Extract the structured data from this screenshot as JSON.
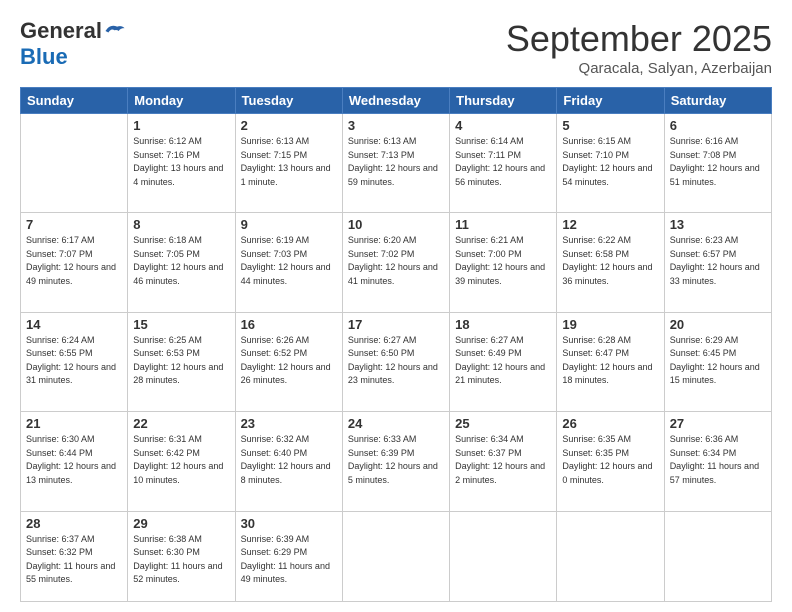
{
  "logo": {
    "general": "General",
    "blue": "Blue"
  },
  "header": {
    "month": "September 2025",
    "location": "Qaracala, Salyan, Azerbaijan"
  },
  "days": [
    "Sunday",
    "Monday",
    "Tuesday",
    "Wednesday",
    "Thursday",
    "Friday",
    "Saturday"
  ],
  "weeks": [
    [
      {
        "day": "",
        "sunrise": "",
        "sunset": "",
        "daylight": ""
      },
      {
        "day": "1",
        "sunrise": "6:12 AM",
        "sunset": "7:16 PM",
        "daylight": "13 hours and 4 minutes."
      },
      {
        "day": "2",
        "sunrise": "6:13 AM",
        "sunset": "7:15 PM",
        "daylight": "13 hours and 1 minute."
      },
      {
        "day": "3",
        "sunrise": "6:13 AM",
        "sunset": "7:13 PM",
        "daylight": "12 hours and 59 minutes."
      },
      {
        "day": "4",
        "sunrise": "6:14 AM",
        "sunset": "7:11 PM",
        "daylight": "12 hours and 56 minutes."
      },
      {
        "day": "5",
        "sunrise": "6:15 AM",
        "sunset": "7:10 PM",
        "daylight": "12 hours and 54 minutes."
      },
      {
        "day": "6",
        "sunrise": "6:16 AM",
        "sunset": "7:08 PM",
        "daylight": "12 hours and 51 minutes."
      }
    ],
    [
      {
        "day": "7",
        "sunrise": "6:17 AM",
        "sunset": "7:07 PM",
        "daylight": "12 hours and 49 minutes."
      },
      {
        "day": "8",
        "sunrise": "6:18 AM",
        "sunset": "7:05 PM",
        "daylight": "12 hours and 46 minutes."
      },
      {
        "day": "9",
        "sunrise": "6:19 AM",
        "sunset": "7:03 PM",
        "daylight": "12 hours and 44 minutes."
      },
      {
        "day": "10",
        "sunrise": "6:20 AM",
        "sunset": "7:02 PM",
        "daylight": "12 hours and 41 minutes."
      },
      {
        "day": "11",
        "sunrise": "6:21 AM",
        "sunset": "7:00 PM",
        "daylight": "12 hours and 39 minutes."
      },
      {
        "day": "12",
        "sunrise": "6:22 AM",
        "sunset": "6:58 PM",
        "daylight": "12 hours and 36 minutes."
      },
      {
        "day": "13",
        "sunrise": "6:23 AM",
        "sunset": "6:57 PM",
        "daylight": "12 hours and 33 minutes."
      }
    ],
    [
      {
        "day": "14",
        "sunrise": "6:24 AM",
        "sunset": "6:55 PM",
        "daylight": "12 hours and 31 minutes."
      },
      {
        "day": "15",
        "sunrise": "6:25 AM",
        "sunset": "6:53 PM",
        "daylight": "12 hours and 28 minutes."
      },
      {
        "day": "16",
        "sunrise": "6:26 AM",
        "sunset": "6:52 PM",
        "daylight": "12 hours and 26 minutes."
      },
      {
        "day": "17",
        "sunrise": "6:27 AM",
        "sunset": "6:50 PM",
        "daylight": "12 hours and 23 minutes."
      },
      {
        "day": "18",
        "sunrise": "6:27 AM",
        "sunset": "6:49 PM",
        "daylight": "12 hours and 21 minutes."
      },
      {
        "day": "19",
        "sunrise": "6:28 AM",
        "sunset": "6:47 PM",
        "daylight": "12 hours and 18 minutes."
      },
      {
        "day": "20",
        "sunrise": "6:29 AM",
        "sunset": "6:45 PM",
        "daylight": "12 hours and 15 minutes."
      }
    ],
    [
      {
        "day": "21",
        "sunrise": "6:30 AM",
        "sunset": "6:44 PM",
        "daylight": "12 hours and 13 minutes."
      },
      {
        "day": "22",
        "sunrise": "6:31 AM",
        "sunset": "6:42 PM",
        "daylight": "12 hours and 10 minutes."
      },
      {
        "day": "23",
        "sunrise": "6:32 AM",
        "sunset": "6:40 PM",
        "daylight": "12 hours and 8 minutes."
      },
      {
        "day": "24",
        "sunrise": "6:33 AM",
        "sunset": "6:39 PM",
        "daylight": "12 hours and 5 minutes."
      },
      {
        "day": "25",
        "sunrise": "6:34 AM",
        "sunset": "6:37 PM",
        "daylight": "12 hours and 2 minutes."
      },
      {
        "day": "26",
        "sunrise": "6:35 AM",
        "sunset": "6:35 PM",
        "daylight": "12 hours and 0 minutes."
      },
      {
        "day": "27",
        "sunrise": "6:36 AM",
        "sunset": "6:34 PM",
        "daylight": "11 hours and 57 minutes."
      }
    ],
    [
      {
        "day": "28",
        "sunrise": "6:37 AM",
        "sunset": "6:32 PM",
        "daylight": "11 hours and 55 minutes."
      },
      {
        "day": "29",
        "sunrise": "6:38 AM",
        "sunset": "6:30 PM",
        "daylight": "11 hours and 52 minutes."
      },
      {
        "day": "30",
        "sunrise": "6:39 AM",
        "sunset": "6:29 PM",
        "daylight": "11 hours and 49 minutes."
      },
      {
        "day": "",
        "sunrise": "",
        "sunset": "",
        "daylight": ""
      },
      {
        "day": "",
        "sunrise": "",
        "sunset": "",
        "daylight": ""
      },
      {
        "day": "",
        "sunrise": "",
        "sunset": "",
        "daylight": ""
      },
      {
        "day": "",
        "sunrise": "",
        "sunset": "",
        "daylight": ""
      }
    ]
  ]
}
